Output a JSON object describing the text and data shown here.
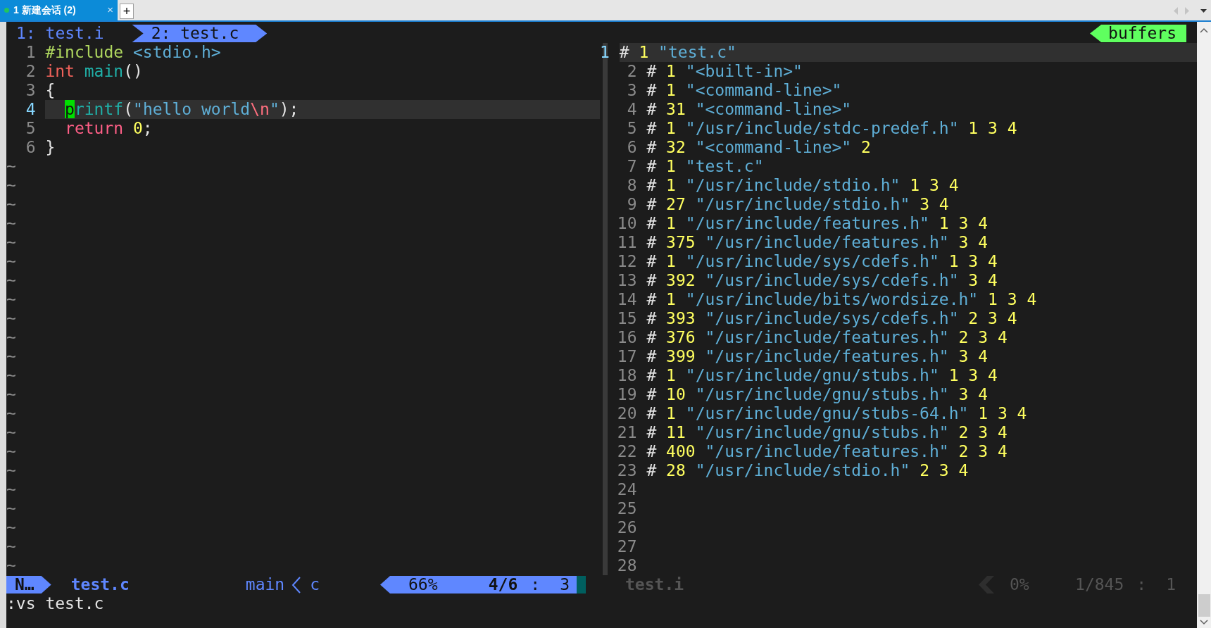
{
  "window_tabs": [
    {
      "label": "1 新建会话 (2)",
      "selected": true,
      "close": "×"
    }
  ],
  "new_tab": "+",
  "vim_tabs": [
    {
      "label": "1: test.i",
      "selected": false
    },
    {
      "label": "2: test.c",
      "selected": true
    }
  ],
  "buffers_label": "buffers",
  "panes": [
    {
      "active": true,
      "lines": [
        {
          "number": "1",
          "current": false,
          "segments": [
            {
              "text": "#include",
              "kind": "preproc"
            },
            {
              "text": " <stdio.h>",
              "kind": "string"
            }
          ]
        },
        {
          "number": "2",
          "current": false,
          "segments": [
            {
              "text": "int",
              "kind": "type"
            },
            {
              "text": " main",
              "kind": "func"
            },
            {
              "text": "()",
              "kind": "plain"
            }
          ]
        },
        {
          "number": "3",
          "current": false,
          "segments": [
            {
              "text": "{",
              "kind": "plain"
            }
          ]
        },
        {
          "number": "4",
          "current": true,
          "indent": true,
          "segments": [
            {
              "text": "p",
              "kind": "cursor"
            },
            {
              "text": "rintf",
              "kind": "func"
            },
            {
              "text": "(",
              "kind": "plain"
            },
            {
              "text": "\"hello world",
              "kind": "string"
            },
            {
              "text": "\\n",
              "kind": "escape"
            },
            {
              "text": "\"",
              "kind": "string"
            },
            {
              "text": ");",
              "kind": "plain"
            }
          ]
        },
        {
          "number": "5",
          "current": false,
          "indent": true,
          "segments": [
            {
              "text": "return",
              "kind": "keyword"
            },
            {
              "text": " 0",
              "kind": "number"
            },
            {
              "text": ";",
              "kind": "plain"
            }
          ]
        },
        {
          "number": "6",
          "current": false,
          "segments": [
            {
              "text": "}",
              "kind": "plain"
            }
          ]
        },
        {
          "filler": "~"
        },
        {
          "filler": "~"
        },
        {
          "filler": "~"
        },
        {
          "filler": "~"
        },
        {
          "filler": "~"
        },
        {
          "filler": "~"
        },
        {
          "filler": "~"
        },
        {
          "filler": "~"
        },
        {
          "filler": "~"
        },
        {
          "filler": "~"
        },
        {
          "filler": "~"
        },
        {
          "filler": "~"
        },
        {
          "filler": "~"
        },
        {
          "filler": "~"
        },
        {
          "filler": "~"
        },
        {
          "filler": "~"
        },
        {
          "filler": "~"
        },
        {
          "filler": "~"
        },
        {
          "filler": "~"
        },
        {
          "filler": "~"
        },
        {
          "filler": "~"
        },
        {
          "filler": "~"
        }
      ],
      "status": {
        "mode": "N…",
        "file": "test.c",
        "function": "main",
        "filetype": "c",
        "percent": "66%",
        "position": "4/6",
        "separator": ":",
        "column": "3"
      }
    },
    {
      "active": false,
      "lines": [
        {
          "number": "1",
          "current": true,
          "segments": [
            {
              "text": "#",
              "kind": "plain"
            },
            {
              "text": " 1",
              "kind": "number"
            },
            {
              "text": " \"test.c\"",
              "kind": "string"
            }
          ]
        },
        {
          "number": "2",
          "current": false,
          "segments": [
            {
              "text": "#",
              "kind": "plain"
            },
            {
              "text": " 1",
              "kind": "number"
            },
            {
              "text": " \"<built-in>\"",
              "kind": "string"
            }
          ]
        },
        {
          "number": "3",
          "current": false,
          "segments": [
            {
              "text": "#",
              "kind": "plain"
            },
            {
              "text": " 1",
              "kind": "number"
            },
            {
              "text": " \"<command-line>\"",
              "kind": "string"
            }
          ]
        },
        {
          "number": "4",
          "current": false,
          "segments": [
            {
              "text": "#",
              "kind": "plain"
            },
            {
              "text": " 31",
              "kind": "number"
            },
            {
              "text": " \"<command-line>\"",
              "kind": "string"
            }
          ]
        },
        {
          "number": "5",
          "current": false,
          "segments": [
            {
              "text": "#",
              "kind": "plain"
            },
            {
              "text": " 1",
              "kind": "number"
            },
            {
              "text": " \"/usr/include/stdc-predef.h\"",
              "kind": "string"
            },
            {
              "text": " 1 3 4",
              "kind": "number"
            }
          ]
        },
        {
          "number": "6",
          "current": false,
          "segments": [
            {
              "text": "#",
              "kind": "plain"
            },
            {
              "text": " 32",
              "kind": "number"
            },
            {
              "text": " \"<command-line>\"",
              "kind": "string"
            },
            {
              "text": " 2",
              "kind": "number"
            }
          ]
        },
        {
          "number": "7",
          "current": false,
          "segments": [
            {
              "text": "#",
              "kind": "plain"
            },
            {
              "text": " 1",
              "kind": "number"
            },
            {
              "text": " \"test.c\"",
              "kind": "string"
            }
          ]
        },
        {
          "number": "8",
          "current": false,
          "segments": [
            {
              "text": "#",
              "kind": "plain"
            },
            {
              "text": " 1",
              "kind": "number"
            },
            {
              "text": " \"/usr/include/stdio.h\"",
              "kind": "string"
            },
            {
              "text": " 1 3 4",
              "kind": "number"
            }
          ]
        },
        {
          "number": "9",
          "current": false,
          "segments": [
            {
              "text": "#",
              "kind": "plain"
            },
            {
              "text": " 27",
              "kind": "number"
            },
            {
              "text": " \"/usr/include/stdio.h\"",
              "kind": "string"
            },
            {
              "text": " 3 4",
              "kind": "number"
            }
          ]
        },
        {
          "number": "10",
          "current": false,
          "segments": [
            {
              "text": "#",
              "kind": "plain"
            },
            {
              "text": " 1",
              "kind": "number"
            },
            {
              "text": " \"/usr/include/features.h\"",
              "kind": "string"
            },
            {
              "text": " 1 3 4",
              "kind": "number"
            }
          ]
        },
        {
          "number": "11",
          "current": false,
          "segments": [
            {
              "text": "#",
              "kind": "plain"
            },
            {
              "text": " 375",
              "kind": "number"
            },
            {
              "text": " \"/usr/include/features.h\"",
              "kind": "string"
            },
            {
              "text": " 3 4",
              "kind": "number"
            }
          ]
        },
        {
          "number": "12",
          "current": false,
          "segments": [
            {
              "text": "#",
              "kind": "plain"
            },
            {
              "text": " 1",
              "kind": "number"
            },
            {
              "text": " \"/usr/include/sys/cdefs.h\"",
              "kind": "string"
            },
            {
              "text": " 1 3 4",
              "kind": "number"
            }
          ]
        },
        {
          "number": "13",
          "current": false,
          "segments": [
            {
              "text": "#",
              "kind": "plain"
            },
            {
              "text": " 392",
              "kind": "number"
            },
            {
              "text": " \"/usr/include/sys/cdefs.h\"",
              "kind": "string"
            },
            {
              "text": " 3 4",
              "kind": "number"
            }
          ]
        },
        {
          "number": "14",
          "current": false,
          "segments": [
            {
              "text": "#",
              "kind": "plain"
            },
            {
              "text": " 1",
              "kind": "number"
            },
            {
              "text": " \"/usr/include/bits/wordsize.h\"",
              "kind": "string"
            },
            {
              "text": " 1 3 4",
              "kind": "number"
            }
          ]
        },
        {
          "number": "15",
          "current": false,
          "segments": [
            {
              "text": "#",
              "kind": "plain"
            },
            {
              "text": " 393",
              "kind": "number"
            },
            {
              "text": " \"/usr/include/sys/cdefs.h\"",
              "kind": "string"
            },
            {
              "text": " 2 3 4",
              "kind": "number"
            }
          ]
        },
        {
          "number": "16",
          "current": false,
          "segments": [
            {
              "text": "#",
              "kind": "plain"
            },
            {
              "text": " 376",
              "kind": "number"
            },
            {
              "text": " \"/usr/include/features.h\"",
              "kind": "string"
            },
            {
              "text": " 2 3 4",
              "kind": "number"
            }
          ]
        },
        {
          "number": "17",
          "current": false,
          "segments": [
            {
              "text": "#",
              "kind": "plain"
            },
            {
              "text": " 399",
              "kind": "number"
            },
            {
              "text": " \"/usr/include/features.h\"",
              "kind": "string"
            },
            {
              "text": " 3 4",
              "kind": "number"
            }
          ]
        },
        {
          "number": "18",
          "current": false,
          "segments": [
            {
              "text": "#",
              "kind": "plain"
            },
            {
              "text": " 1",
              "kind": "number"
            },
            {
              "text": " \"/usr/include/gnu/stubs.h\"",
              "kind": "string"
            },
            {
              "text": " 1 3 4",
              "kind": "number"
            }
          ]
        },
        {
          "number": "19",
          "current": false,
          "segments": [
            {
              "text": "#",
              "kind": "plain"
            },
            {
              "text": " 10",
              "kind": "number"
            },
            {
              "text": " \"/usr/include/gnu/stubs.h\"",
              "kind": "string"
            },
            {
              "text": " 3 4",
              "kind": "number"
            }
          ]
        },
        {
          "number": "20",
          "current": false,
          "segments": [
            {
              "text": "#",
              "kind": "plain"
            },
            {
              "text": " 1",
              "kind": "number"
            },
            {
              "text": " \"/usr/include/gnu/stubs-64.h\"",
              "kind": "string"
            },
            {
              "text": " 1 3 4",
              "kind": "number"
            }
          ]
        },
        {
          "number": "21",
          "current": false,
          "segments": [
            {
              "text": "#",
              "kind": "plain"
            },
            {
              "text": " 11",
              "kind": "number"
            },
            {
              "text": " \"/usr/include/gnu/stubs.h\"",
              "kind": "string"
            },
            {
              "text": " 2 3 4",
              "kind": "number"
            }
          ]
        },
        {
          "number": "22",
          "current": false,
          "segments": [
            {
              "text": "#",
              "kind": "plain"
            },
            {
              "text": " 400",
              "kind": "number"
            },
            {
              "text": " \"/usr/include/features.h\"",
              "kind": "string"
            },
            {
              "text": " 2 3 4",
              "kind": "number"
            }
          ]
        },
        {
          "number": "23",
          "current": false,
          "segments": [
            {
              "text": "#",
              "kind": "plain"
            },
            {
              "text": " 28",
              "kind": "number"
            },
            {
              "text": " \"/usr/include/stdio.h\"",
              "kind": "string"
            },
            {
              "text": " 2 3 4",
              "kind": "number"
            }
          ]
        },
        {
          "number": "24",
          "current": false
        },
        {
          "number": "25",
          "current": false
        },
        {
          "number": "26",
          "current": false
        },
        {
          "number": "27",
          "current": false
        },
        {
          "number": "28",
          "current": false
        }
      ],
      "status": {
        "file": "test.i",
        "percent": "0%",
        "position": "1/845",
        "separator": ":",
        "column": "1"
      }
    }
  ],
  "command_line": ":vs test.c"
}
